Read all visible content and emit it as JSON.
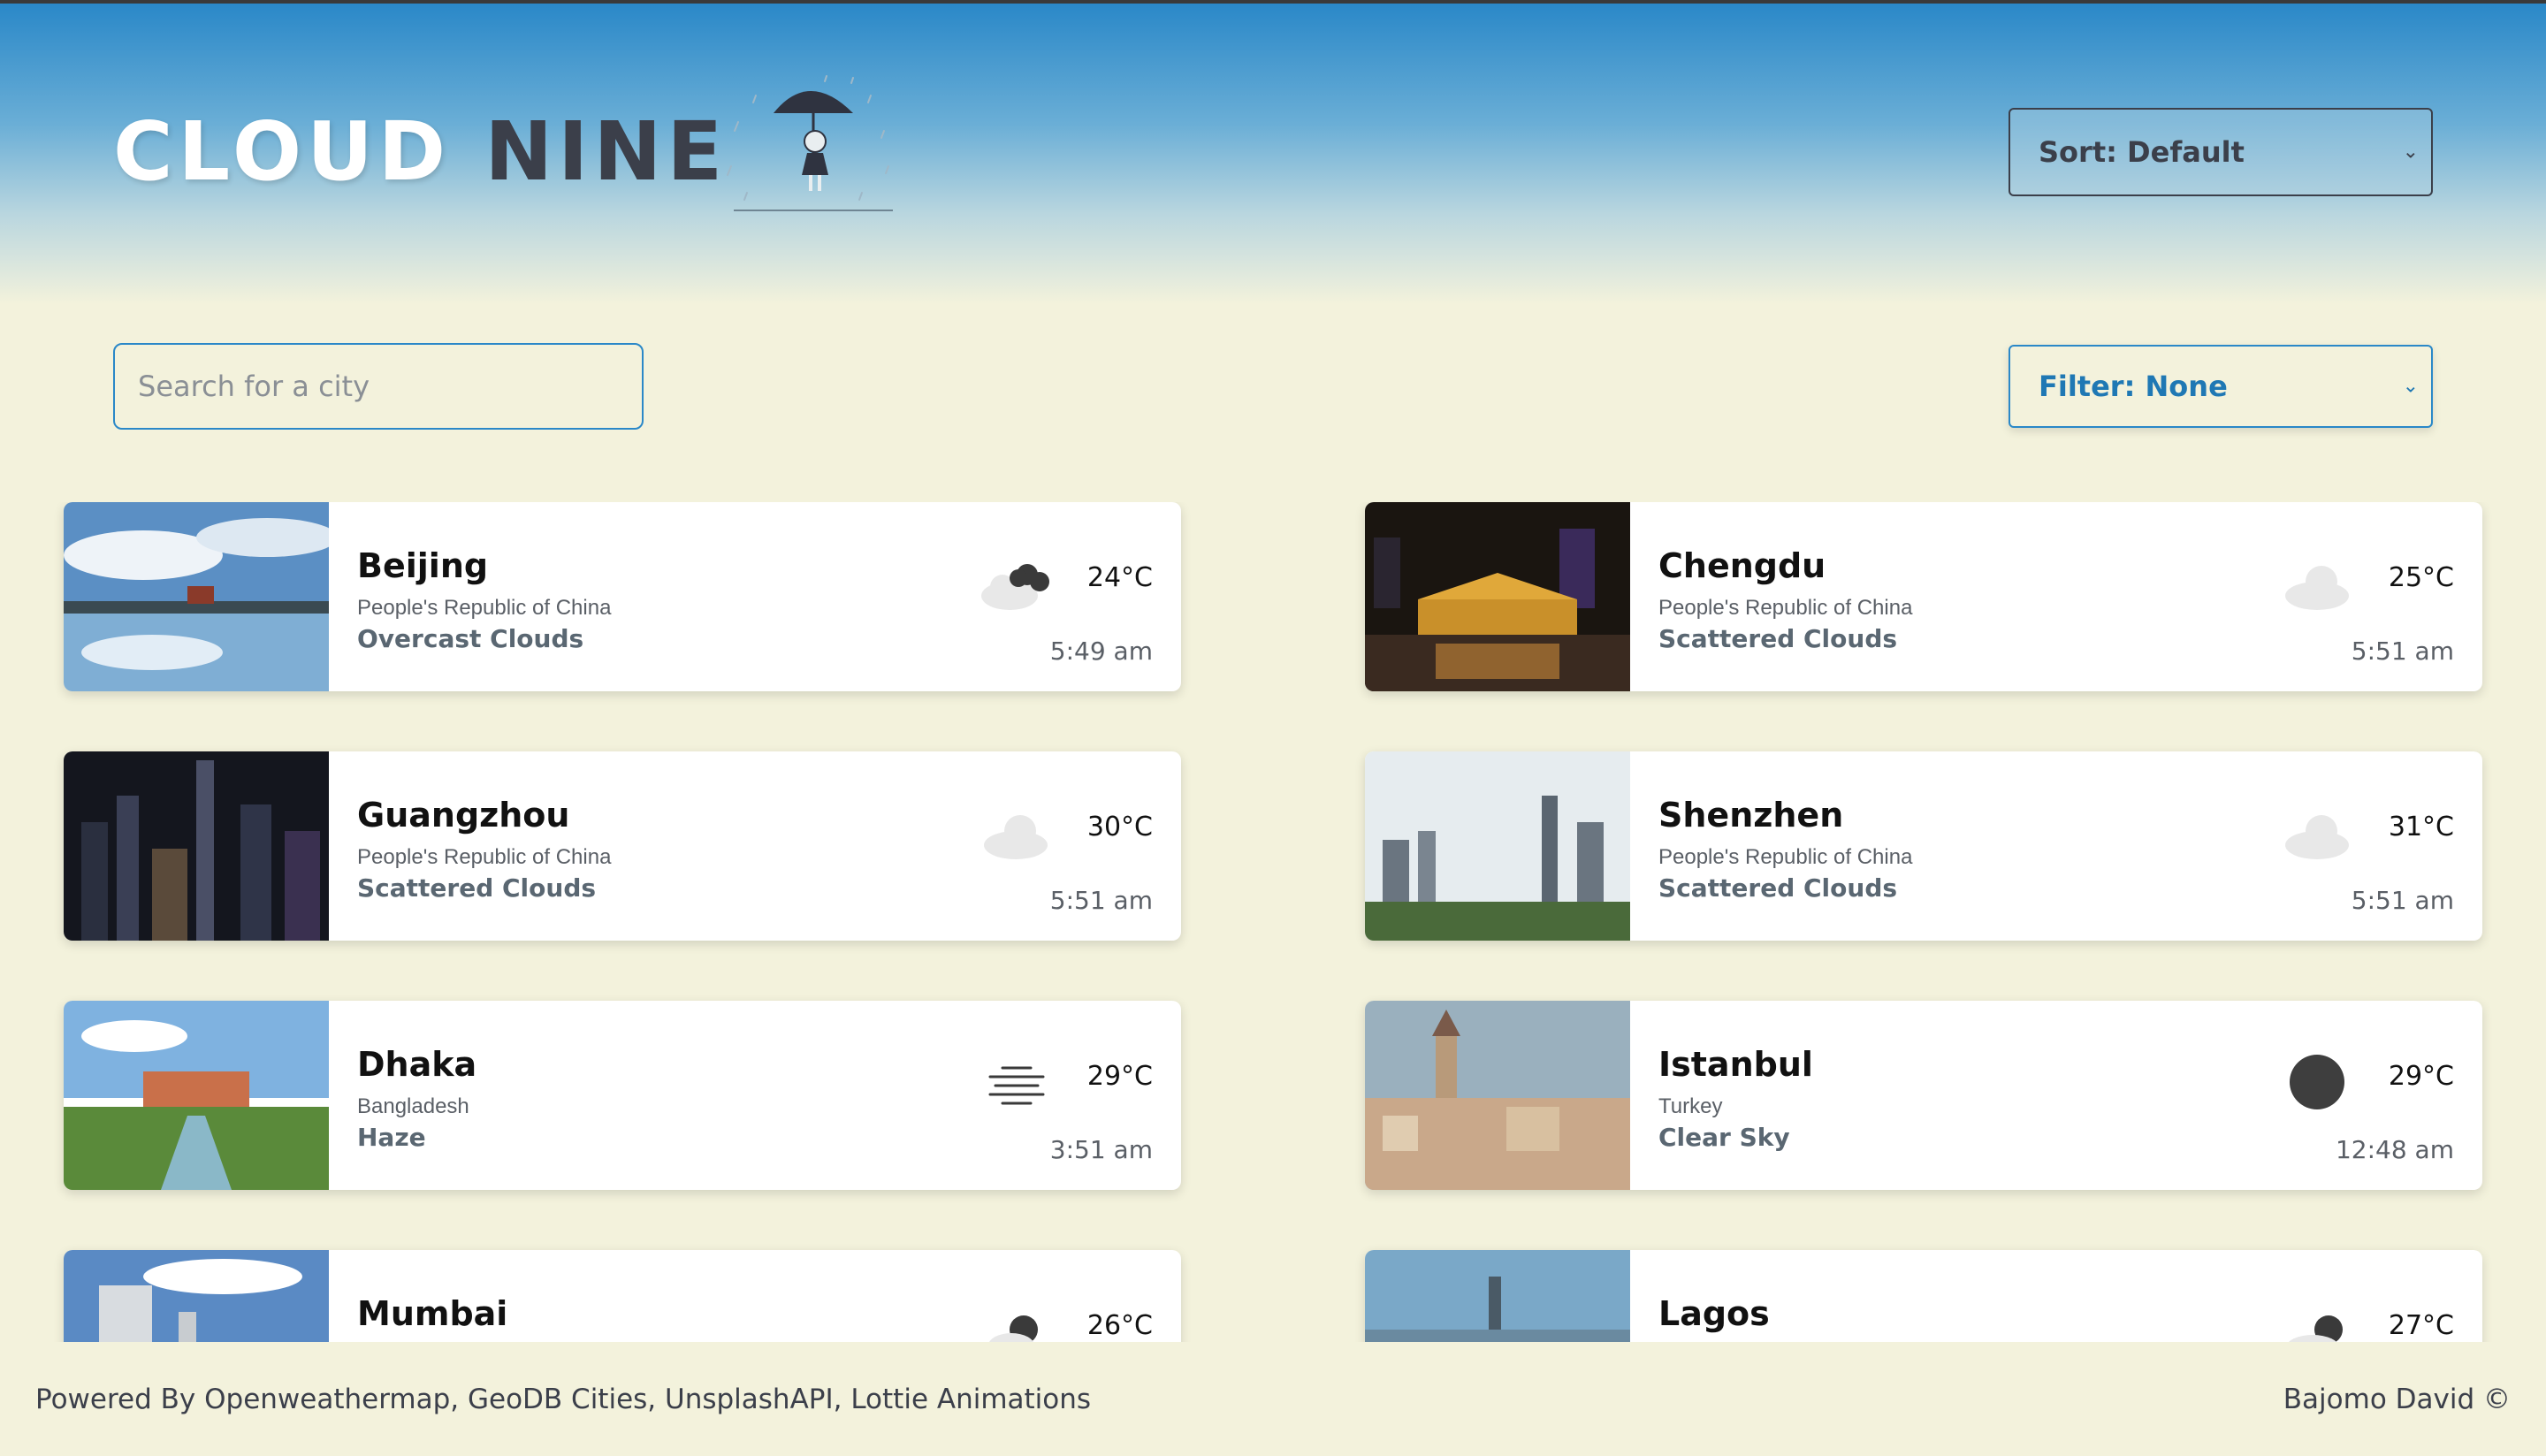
{
  "app": {
    "brand_part1": "CLOUD",
    "brand_part2": "NINE"
  },
  "controls": {
    "sort_label": "Sort: Default",
    "filter_label": "Filter: None",
    "search_placeholder": "Search for a city",
    "search_value": ""
  },
  "cards": [
    {
      "city": "Beijing",
      "country": "People's Republic of China",
      "description": "Overcast Clouds",
      "temperature": "24°C",
      "time": "5:49 am",
      "icon": "overcast-clouds-icon"
    },
    {
      "city": "Chengdu",
      "country": "People's Republic of China",
      "description": "Scattered Clouds",
      "temperature": "25°C",
      "time": "5:51 am",
      "icon": "scattered-clouds-icon"
    },
    {
      "city": "Guangzhou",
      "country": "People's Republic of China",
      "description": "Scattered Clouds",
      "temperature": "30°C",
      "time": "5:51 am",
      "icon": "scattered-clouds-icon"
    },
    {
      "city": "Shenzhen",
      "country": "People's Republic of China",
      "description": "Scattered Clouds",
      "temperature": "31°C",
      "time": "5:51 am",
      "icon": "scattered-clouds-icon"
    },
    {
      "city": "Dhaka",
      "country": "Bangladesh",
      "description": "Haze",
      "temperature": "29°C",
      "time": "3:51 am",
      "icon": "haze-icon"
    },
    {
      "city": "Istanbul",
      "country": "Turkey",
      "description": "Clear Sky",
      "temperature": "29°C",
      "time": "12:48 am",
      "icon": "clear-night-icon"
    },
    {
      "city": "Mumbai",
      "temperature": "26°C",
      "icon": "rain-night-icon"
    },
    {
      "city": "Lagos",
      "temperature": "27°C",
      "icon": "cloudy-night-icon"
    }
  ],
  "footer": {
    "credits": "Powered By Openweathermap, GeoDB Cities, UnsplashAPI, Lottie Animations",
    "author": "Bajomo David ©"
  },
  "colors": {
    "background": "#f3f2dc",
    "header_blue": "#2a88c8",
    "accent": "#1f78b4",
    "dark_text": "#3b3f4a"
  }
}
